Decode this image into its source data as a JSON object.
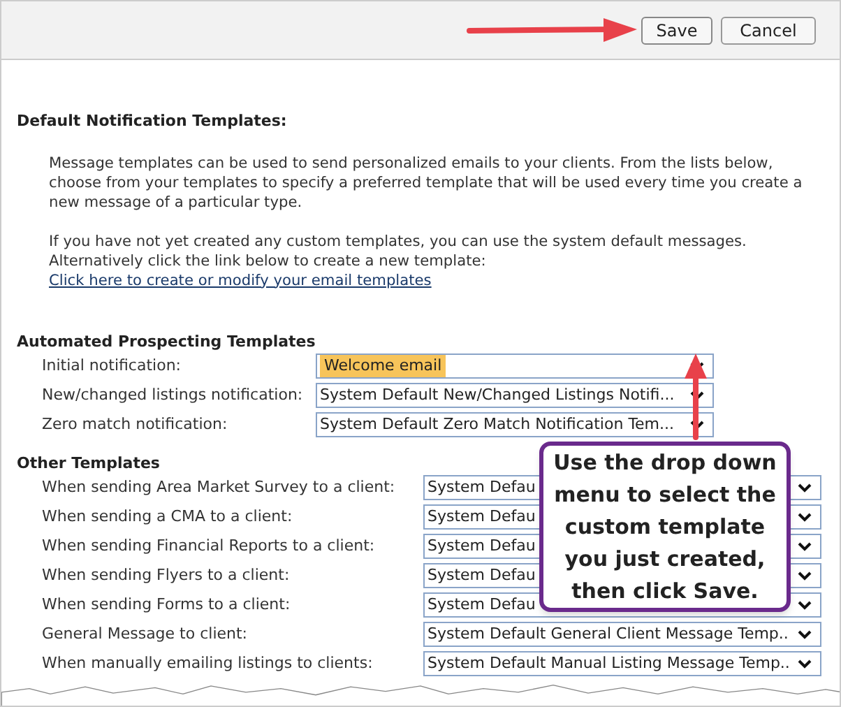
{
  "toolbar": {
    "buttons": [
      {
        "label": "Save",
        "kind": "primary"
      },
      {
        "label": "Cancel",
        "kind": "secondary"
      }
    ]
  },
  "intro": {
    "title": "Default Notification Templates:",
    "paragraphs": [
      "Message templates can be used to send personalized emails to your clients. From the lists below, choose from your templates to specify a preferred template that will be used every time you create a new message of a particular type.",
      "If you have not yet created any custom templates, you can use the system default messages. Alternatively click the link below to create a new template:"
    ],
    "link": "Click here to create or modify your email templates"
  },
  "sections": [
    {
      "title": "Automated Prospecting Templates",
      "rows": [
        {
          "label": "Initial notification:",
          "value": "Welcome email",
          "highlighted": true
        },
        {
          "label": "New/changed listings notification:",
          "value": "System Default New/Changed Listings Notifi...",
          "highlighted": false
        },
        {
          "label": "Zero match notification:",
          "value": "System Default Zero Match Notification Tem...",
          "highlighted": false
        }
      ]
    },
    {
      "title": "Other Templates",
      "rows": [
        {
          "label": "When sending Area Market Survey to a client:",
          "value": "System Defau",
          "highlighted": false
        },
        {
          "label": "When sending a CMA to a client:",
          "value": "System Defau",
          "highlighted": false
        },
        {
          "label": "When sending Financial Reports to a client:",
          "value": "System Defau",
          "highlighted": false
        },
        {
          "label": "When sending Flyers to a client:",
          "value": "System Defau",
          "highlighted": false
        },
        {
          "label": "When sending Forms to a client:",
          "value": "System Defau",
          "highlighted": false
        },
        {
          "label": "General Message to client:",
          "value": "System Default General Client Message Temp..",
          "highlighted": false
        },
        {
          "label": "When manually emailing listings to clients:",
          "value": "System Default Manual Listing Message Temp..",
          "highlighted": false
        }
      ]
    }
  ],
  "callout": {
    "text": "Use the drop down menu to select the custom template you just created, then click Save."
  }
}
